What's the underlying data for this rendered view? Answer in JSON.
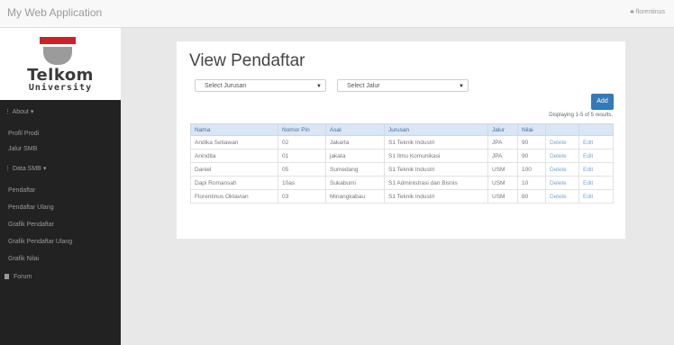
{
  "app": {
    "title": "My Web Application",
    "user": "florentinus"
  },
  "logo": {
    "line1": "Telkom",
    "line2": "University"
  },
  "sidebar": {
    "about_label": "About",
    "about_items": [
      "Profil Prodi",
      "Jalur SMB"
    ],
    "data_label": "Data SMB",
    "data_items": [
      "Pendaftar",
      "Pendaftar Ulang",
      "Grafik Pendaftar",
      "Grafik Pendaftar Ulang",
      "Grafik Nilai"
    ],
    "forum_label": "Forum"
  },
  "page": {
    "title": "View Pendaftar",
    "jurusan_select": "Select Jurusan",
    "jalur_select": "Select Jalur",
    "add_label": "Add",
    "summary": "Displaying 1-5 of 5 results."
  },
  "table": {
    "headers": [
      "Nama",
      "Nomor Pin",
      "Asal",
      "Jurusan",
      "Jalur",
      "Nilai",
      "",
      ""
    ],
    "rows": [
      [
        "Andika Setiawan",
        "02",
        "Jakarta",
        "S1 Teknik Industri",
        "JPA",
        "90",
        "Delete",
        "Edit"
      ],
      [
        "Anindita",
        "01",
        "jakata",
        "S1 Ilmu Komunikasi",
        "JPA",
        "90",
        "Delete",
        "Edit"
      ],
      [
        "Daniel",
        "05",
        "Sumedang",
        "S1 Teknik Industri",
        "USM",
        "100",
        "Delete",
        "Edit"
      ],
      [
        "Dapi Romansah",
        "10as",
        "Sukabumi",
        "S1 Administrasi dan Bisnis",
        "USM",
        "10",
        "Delete",
        "Edit"
      ],
      [
        "Florentinus Oktavian",
        "03",
        "Minangkabau",
        "S1 Teknik Industri",
        "USM",
        "80",
        "Delete",
        "Edit"
      ]
    ]
  }
}
